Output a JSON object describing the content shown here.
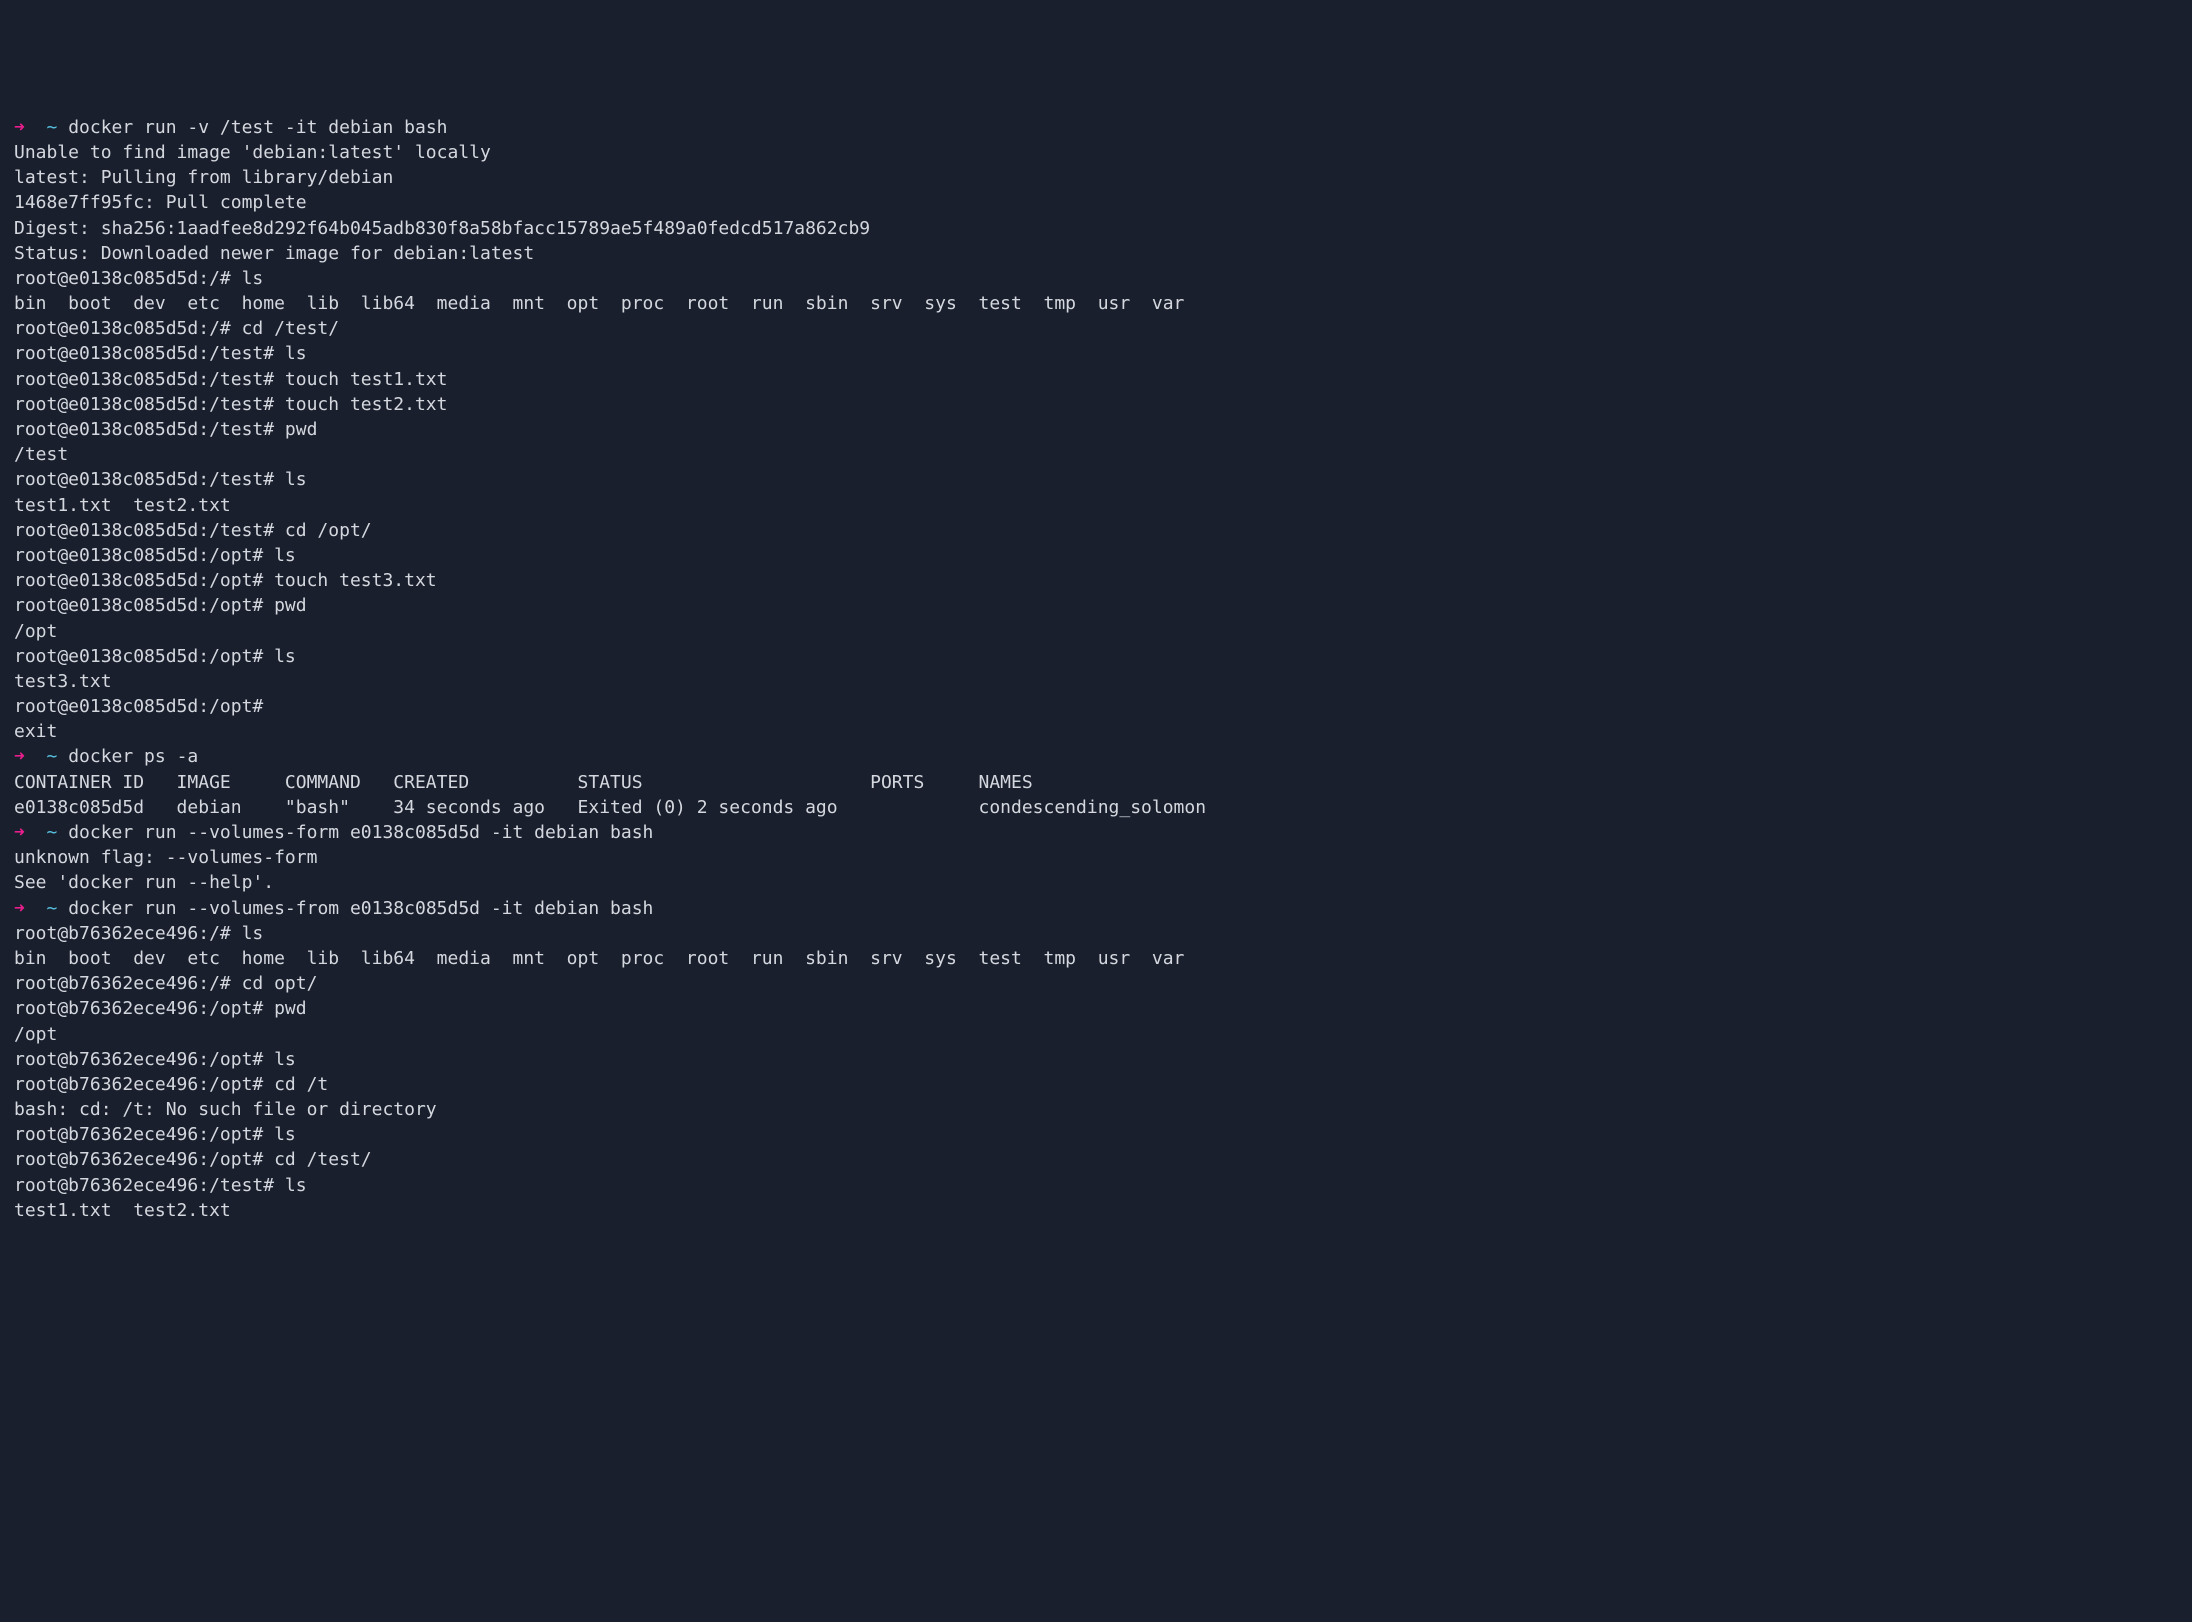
{
  "lines": [
    {
      "segments": [
        {
          "class": "arrow",
          "text": "➜  "
        },
        {
          "class": "tilde",
          "text": "~"
        },
        {
          "class": "normal",
          "text": " docker run -v /test -it debian bash"
        }
      ]
    },
    {
      "segments": [
        {
          "class": "normal",
          "text": "Unable to find image 'debian:latest' locally"
        }
      ]
    },
    {
      "segments": [
        {
          "class": "normal",
          "text": "latest: Pulling from library/debian"
        }
      ]
    },
    {
      "segments": [
        {
          "class": "normal",
          "text": "1468e7ff95fc: Pull complete"
        }
      ]
    },
    {
      "segments": [
        {
          "class": "normal",
          "text": "Digest: sha256:1aadfee8d292f64b045adb830f8a58bfacc15789ae5f489a0fedcd517a862cb9"
        }
      ]
    },
    {
      "segments": [
        {
          "class": "normal",
          "text": "Status: Downloaded newer image for debian:latest"
        }
      ]
    },
    {
      "segments": [
        {
          "class": "normal",
          "text": "root@e0138c085d5d:/# ls"
        }
      ]
    },
    {
      "segments": [
        {
          "class": "normal",
          "text": "bin  boot  dev  etc  home  lib  lib64  media  mnt  opt  proc  root  run  sbin  srv  sys  test  tmp  usr  var"
        }
      ]
    },
    {
      "segments": [
        {
          "class": "normal",
          "text": "root@e0138c085d5d:/# cd /test/"
        }
      ]
    },
    {
      "segments": [
        {
          "class": "normal",
          "text": "root@e0138c085d5d:/test# ls"
        }
      ]
    },
    {
      "segments": [
        {
          "class": "normal",
          "text": "root@e0138c085d5d:/test# touch test1.txt"
        }
      ]
    },
    {
      "segments": [
        {
          "class": "normal",
          "text": "root@e0138c085d5d:/test# touch test2.txt"
        }
      ]
    },
    {
      "segments": [
        {
          "class": "normal",
          "text": "root@e0138c085d5d:/test# pwd"
        }
      ]
    },
    {
      "segments": [
        {
          "class": "normal",
          "text": "/test"
        }
      ]
    },
    {
      "segments": [
        {
          "class": "normal",
          "text": "root@e0138c085d5d:/test# ls"
        }
      ]
    },
    {
      "segments": [
        {
          "class": "normal",
          "text": "test1.txt  test2.txt"
        }
      ]
    },
    {
      "segments": [
        {
          "class": "normal",
          "text": "root@e0138c085d5d:/test# cd /opt/"
        }
      ]
    },
    {
      "segments": [
        {
          "class": "normal",
          "text": "root@e0138c085d5d:/opt# ls"
        }
      ]
    },
    {
      "segments": [
        {
          "class": "normal",
          "text": "root@e0138c085d5d:/opt# touch test3.txt"
        }
      ]
    },
    {
      "segments": [
        {
          "class": "normal",
          "text": "root@e0138c085d5d:/opt# pwd"
        }
      ]
    },
    {
      "segments": [
        {
          "class": "normal",
          "text": "/opt"
        }
      ]
    },
    {
      "segments": [
        {
          "class": "normal",
          "text": "root@e0138c085d5d:/opt# ls"
        }
      ]
    },
    {
      "segments": [
        {
          "class": "normal",
          "text": "test3.txt"
        }
      ]
    },
    {
      "segments": [
        {
          "class": "normal",
          "text": "root@e0138c085d5d:/opt#"
        }
      ]
    },
    {
      "segments": [
        {
          "class": "normal",
          "text": "exit"
        }
      ]
    },
    {
      "segments": [
        {
          "class": "arrow",
          "text": "➜  "
        },
        {
          "class": "tilde",
          "text": "~"
        },
        {
          "class": "normal",
          "text": " docker ps -a"
        }
      ]
    },
    {
      "segments": [
        {
          "class": "normal",
          "text": "CONTAINER ID   IMAGE     COMMAND   CREATED          STATUS                     PORTS     NAMES"
        }
      ]
    },
    {
      "segments": [
        {
          "class": "normal",
          "text": "e0138c085d5d   debian    \"bash\"    34 seconds ago   Exited (0) 2 seconds ago             condescending_solomon"
        }
      ]
    },
    {
      "segments": [
        {
          "class": "arrow",
          "text": "➜  "
        },
        {
          "class": "tilde",
          "text": "~"
        },
        {
          "class": "normal",
          "text": " docker run --volumes-form e0138c085d5d -it debian bash"
        }
      ]
    },
    {
      "segments": [
        {
          "class": "normal",
          "text": "unknown flag: --volumes-form"
        }
      ]
    },
    {
      "segments": [
        {
          "class": "normal",
          "text": "See 'docker run --help'."
        }
      ]
    },
    {
      "segments": [
        {
          "class": "arrow",
          "text": "➜  "
        },
        {
          "class": "tilde",
          "text": "~"
        },
        {
          "class": "normal",
          "text": " docker run --volumes-from e0138c085d5d -it debian bash"
        }
      ]
    },
    {
      "segments": [
        {
          "class": "normal",
          "text": "root@b76362ece496:/# ls"
        }
      ]
    },
    {
      "segments": [
        {
          "class": "normal",
          "text": "bin  boot  dev  etc  home  lib  lib64  media  mnt  opt  proc  root  run  sbin  srv  sys  test  tmp  usr  var"
        }
      ]
    },
    {
      "segments": [
        {
          "class": "normal",
          "text": "root@b76362ece496:/# cd opt/"
        }
      ]
    },
    {
      "segments": [
        {
          "class": "normal",
          "text": "root@b76362ece496:/opt# pwd"
        }
      ]
    },
    {
      "segments": [
        {
          "class": "normal",
          "text": "/opt"
        }
      ]
    },
    {
      "segments": [
        {
          "class": "normal",
          "text": "root@b76362ece496:/opt# ls"
        }
      ]
    },
    {
      "segments": [
        {
          "class": "normal",
          "text": "root@b76362ece496:/opt# cd /t"
        }
      ]
    },
    {
      "segments": [
        {
          "class": "normal",
          "text": "bash: cd: /t: No such file or directory"
        }
      ]
    },
    {
      "segments": [
        {
          "class": "normal",
          "text": "root@b76362ece496:/opt# ls"
        }
      ]
    },
    {
      "segments": [
        {
          "class": "normal",
          "text": "root@b76362ece496:/opt# cd /test/"
        }
      ]
    },
    {
      "segments": [
        {
          "class": "normal",
          "text": "root@b76362ece496:/test# ls"
        }
      ]
    },
    {
      "segments": [
        {
          "class": "normal",
          "text": "test1.txt  test2.txt"
        }
      ]
    }
  ]
}
